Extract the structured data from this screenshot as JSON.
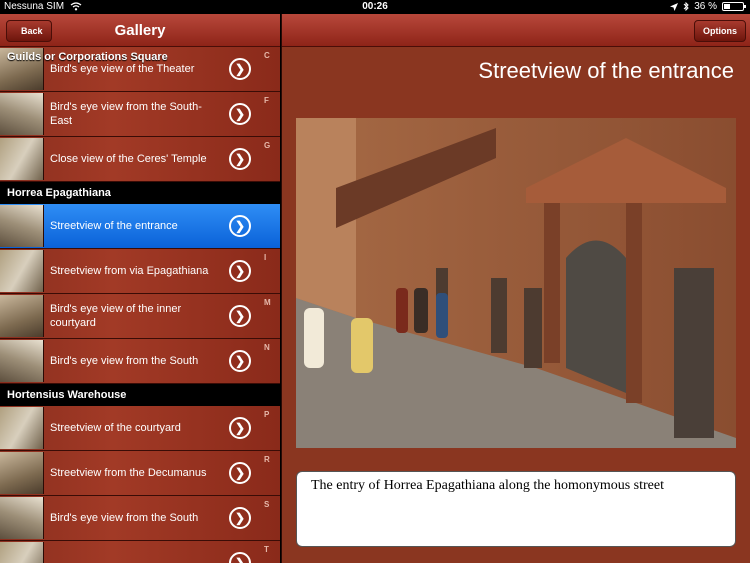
{
  "status": {
    "carrier": "Nessuna SIM",
    "time": "00:26",
    "battery_text": "36 %",
    "battery_level": 0.36
  },
  "left": {
    "title": "Gallery",
    "back_label": "Back",
    "top_section_overlay": "Guilds or Corporations Square",
    "sections": [
      {
        "title": "",
        "rows": [
          {
            "label": "Bird's eye view of the Theater",
            "letter": "C"
          },
          {
            "label": "Bird's eye view from the South-East",
            "letter": "F"
          },
          {
            "label": "Close view of the Ceres' Temple",
            "letter": "G"
          }
        ]
      },
      {
        "title": "Horrea Epagathiana",
        "rows": [
          {
            "label": "Streetview of the entrance",
            "letter": "",
            "selected": true
          },
          {
            "label": "Streetview from via Epagathiana",
            "letter": "I"
          },
          {
            "label": "Bird's eye view of the inner courtyard",
            "letter": "M"
          },
          {
            "label": "Bird's eye view from the South",
            "letter": "N"
          }
        ]
      },
      {
        "title": "Hortensius Warehouse",
        "rows": [
          {
            "label": "Streetview of the courtyard",
            "letter": "P"
          },
          {
            "label": "Streetview from the Decumanus",
            "letter": "R"
          },
          {
            "label": "Bird's eye view from the South",
            "letter": "S"
          },
          {
            "label": "",
            "letter": "T"
          }
        ]
      }
    ]
  },
  "right": {
    "options_label": "Options",
    "title": "Streetview of the entrance",
    "caption": "The entry of Horrea Epagathiana along the homonymous street"
  },
  "icons": {
    "chevron": "❯",
    "wifi": "wifi-icon",
    "location": "location-arrow-icon",
    "bluetooth": "bluetooth-icon"
  },
  "colors": {
    "accent_red": "#8e2418",
    "selected_blue": "#0a62d8",
    "section_black": "#000000"
  }
}
